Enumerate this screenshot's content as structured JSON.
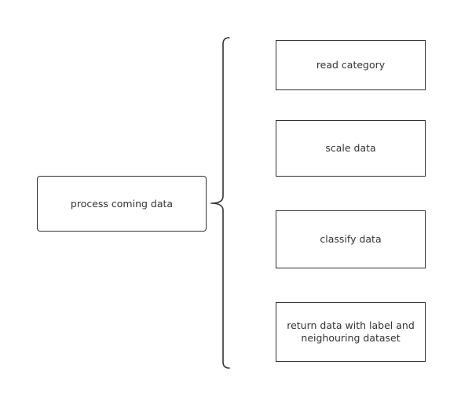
{
  "diagram": {
    "root": {
      "label": "process coming data"
    },
    "children": [
      {
        "label": "read category"
      },
      {
        "label": "scale data"
      },
      {
        "label": "classify data"
      },
      {
        "label": "return data with label and neighouring dataset"
      }
    ]
  },
  "colors": {
    "stroke": "#333333",
    "background": "#ffffff"
  }
}
